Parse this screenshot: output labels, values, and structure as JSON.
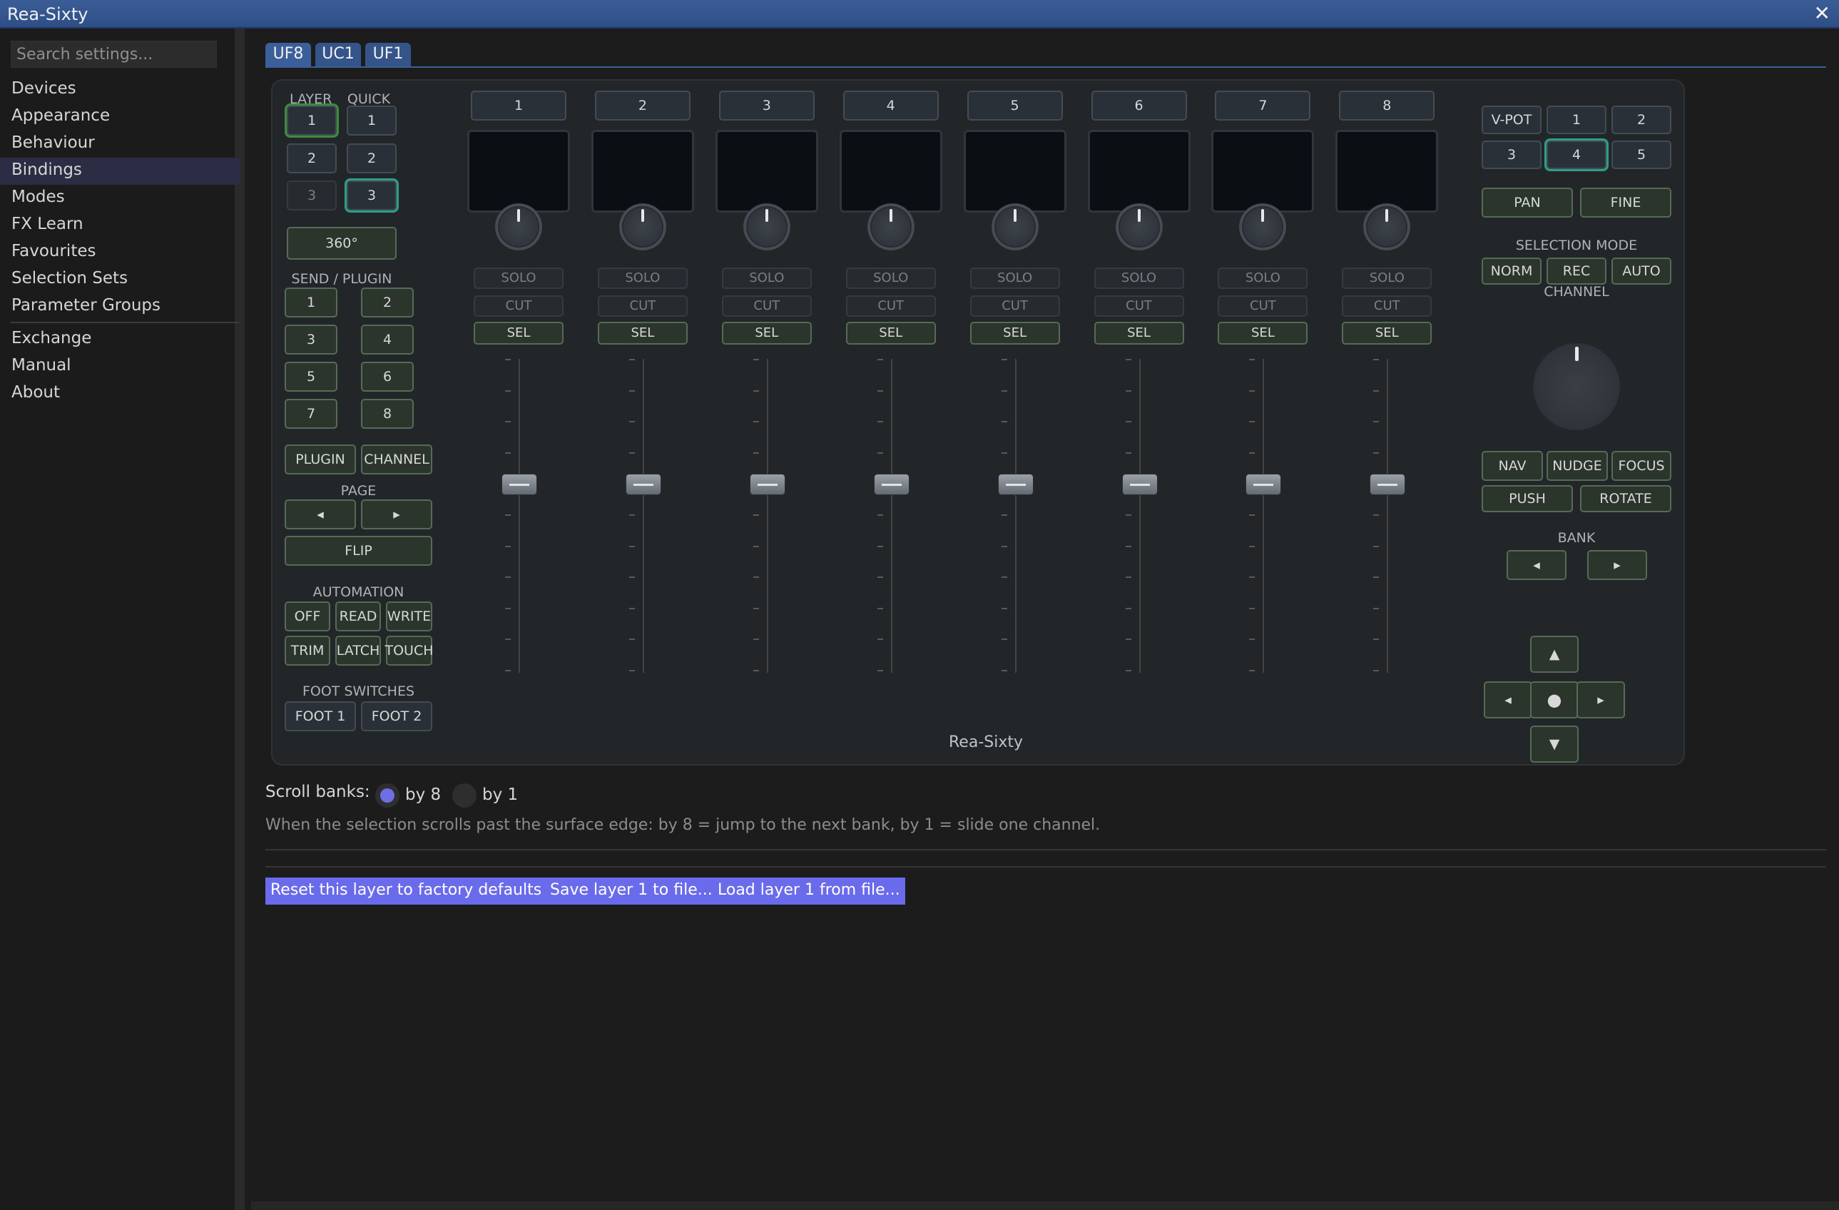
{
  "window": {
    "title": "Rea-Sixty",
    "close_glyph": "✕"
  },
  "search": {
    "placeholder": "Search settings..."
  },
  "sidebar": {
    "items": [
      "Devices",
      "Appearance",
      "Behaviour",
      "Bindings",
      "Modes",
      "FX Learn",
      "Favourites",
      "Selection Sets",
      "Parameter Groups",
      "Exchange",
      "Manual",
      "About"
    ],
    "selected": "Bindings"
  },
  "tabs": [
    "UF8",
    "UC1",
    "UF1"
  ],
  "surface": {
    "layer_label": "LAYER",
    "quick_label": "QUICK",
    "layer_buttons": [
      "1",
      "2",
      "3"
    ],
    "quick_buttons": [
      "1",
      "2",
      "3"
    ],
    "rotate_360": "360°",
    "send_plugin_label": "SEND / PLUGIN",
    "send_buttons": [
      "1",
      "2",
      "3",
      "4",
      "5",
      "6",
      "7",
      "8"
    ],
    "plugin": "PLUGIN",
    "channel": "CHANNEL",
    "page_label": "PAGE",
    "page_prev": "◂",
    "page_next": "▸",
    "flip": "FLIP",
    "automation_label": "AUTOMATION",
    "automation_buttons": [
      "OFF",
      "READ",
      "WRITE",
      "TRIM",
      "LATCH",
      "TOUCH"
    ],
    "foot_label": "FOOT SWITCHES",
    "foot_buttons": [
      "FOOT 1",
      "FOOT 2"
    ],
    "strips": [
      "1",
      "2",
      "3",
      "4",
      "5",
      "6",
      "7",
      "8"
    ],
    "solo": "SOLO",
    "cut": "CUT",
    "sel": "SEL",
    "device_name": "Rea-Sixty",
    "vpot_label": "V-POT",
    "vpot_buttons": [
      "1",
      "2",
      "3",
      "4",
      "5"
    ],
    "pan": "PAN",
    "fine": "FINE",
    "selection_mode_label": "SELECTION MODE",
    "selection_modes": [
      "NORM",
      "REC",
      "AUTO"
    ],
    "channel_label": "CHANNEL",
    "nav": "NAV",
    "nudge": "NUDGE",
    "focus": "FOCUS",
    "push": "PUSH",
    "rotate": "ROTATE",
    "bank_label": "BANK",
    "bank_prev": "◂",
    "bank_next": "▸",
    "arrow_up": "▲",
    "arrow_down": "▼",
    "arrow_left": "◂",
    "arrow_right": "▸",
    "center": "●",
    "fader_level": 0.6
  },
  "scroll_banks": {
    "label": "Scroll banks:",
    "options": [
      "by 8",
      "by 1"
    ],
    "selected": "by 8",
    "hint": "When the selection scrolls past the surface edge: by 8 = jump to the next bank, by 1 = slide one channel."
  },
  "actions": [
    "Reset this layer to factory defaults",
    "Save layer 1 to file...",
    "Load layer 1 from file..."
  ]
}
